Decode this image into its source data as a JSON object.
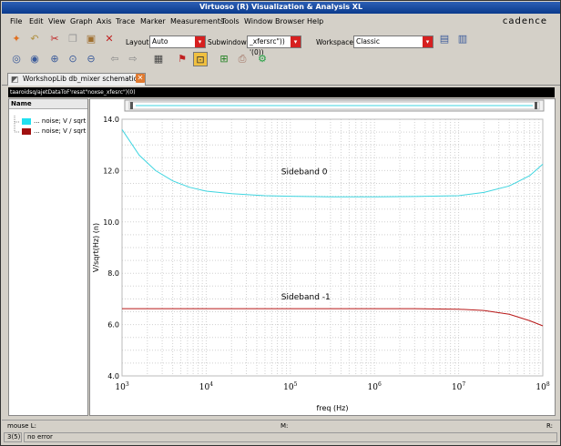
{
  "window": {
    "title": "Virtuoso (R) Visualization & Analysis XL"
  },
  "menu": [
    "File",
    "Edit",
    "View",
    "Graph",
    "Axis",
    "Trace",
    "Marker",
    "Measurements",
    "Tools",
    "Window",
    "Browser",
    "Help"
  ],
  "logo": "cadence",
  "toolbar": {
    "layout_label": "Layout:",
    "layout_value": "Auto",
    "subwindows_label": "Subwindows:",
    "subwindows_value": "_xfersrc\")) '(0))",
    "workspace_label": "Workspace:",
    "workspace_value": "Classic"
  },
  "tab": {
    "label": "WorkshopLib db_mixer schematic"
  },
  "path_text": "taaroidsq/ajetDataToF'resat\"noxse_xfesrc\")(0)",
  "panel": {
    "header": "Name",
    "items": [
      {
        "label": "... noise; V / sqrt",
        "color": "#20e0f0"
      },
      {
        "label": "... noise; V / sqrt",
        "color": "#a01010"
      }
    ]
  },
  "colors": {
    "cyan_trace": "#3ed5e0",
    "red_trace": "#b81818",
    "title_blue": "#0a3a8c"
  },
  "status": {
    "mouse_l": "mouse L:",
    "mouse_m": "M:",
    "mouse_r": "R:",
    "count": "3(5)",
    "message": "no error"
  },
  "chart_data": {
    "type": "line",
    "xlabel": "freq (Hz)",
    "ylabel": "V/sqrt(Hz) (n)",
    "xscale": "log",
    "xlim": [
      1000,
      100000000
    ],
    "ylim": [
      4.0,
      14.0
    ],
    "grid": true,
    "y_ticks": [
      "4.0",
      "6.0",
      "8.0",
      "10.0",
      "12.0",
      "14.0"
    ],
    "x_ticks": [
      {
        "base": "10",
        "exp": "3",
        "value": 1000
      },
      {
        "base": "10",
        "exp": "4",
        "value": 10000
      },
      {
        "base": "10",
        "exp": "5",
        "value": 100000
      },
      {
        "base": "10",
        "exp": "6",
        "value": 1000000
      },
      {
        "base": "10",
        "exp": "7",
        "value": 10000000
      },
      {
        "base": "10",
        "exp": "8",
        "value": 100000000
      }
    ],
    "series": [
      {
        "name": "Sideband 0",
        "color": "#3ed5e0",
        "x": [
          1000,
          1600,
          2500,
          4000,
          6300,
          10000,
          20000,
          50000,
          100000,
          300000,
          1000000,
          3000000,
          10000000,
          20000000,
          40000000,
          70000000,
          100000000
        ],
        "y": [
          13.6,
          12.6,
          12.0,
          11.6,
          11.35,
          11.2,
          11.1,
          11.02,
          11.0,
          10.98,
          10.98,
          10.99,
          11.02,
          11.15,
          11.4,
          11.8,
          12.25
        ]
      },
      {
        "name": "Sideband -1",
        "color": "#b81818",
        "x": [
          1000,
          10000,
          100000,
          1000000,
          3000000,
          10000000,
          20000000,
          40000000,
          70000000,
          100000000
        ],
        "y": [
          6.62,
          6.62,
          6.62,
          6.62,
          6.62,
          6.6,
          6.55,
          6.4,
          6.15,
          5.95
        ]
      }
    ]
  }
}
